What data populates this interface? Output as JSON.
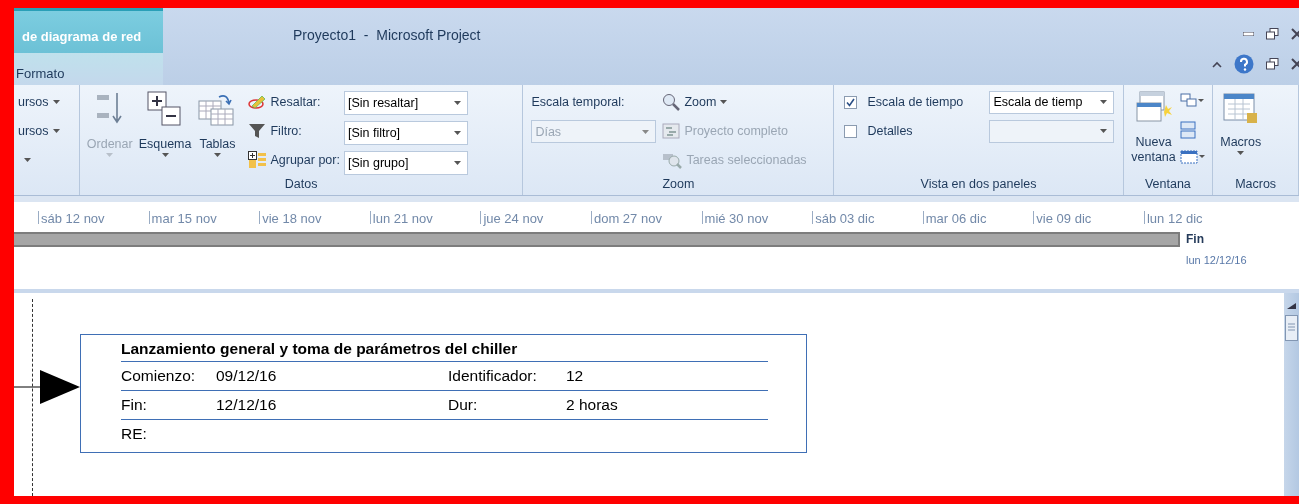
{
  "window": {
    "title": "Proyecto1  -  Microsoft Project"
  },
  "context_tab": {
    "label": "de diagrama de red",
    "tab": "Formato"
  },
  "ribbon": {
    "cut_group": {
      "items": [
        "ursos",
        "ursos"
      ]
    },
    "datos": {
      "label": "Datos",
      "buttons": [
        {
          "kind": "sort",
          "label": "Ordenar",
          "disabled": true
        },
        {
          "kind": "outline",
          "label": "Esquema",
          "disabled": false
        },
        {
          "kind": "tables",
          "label": "Tablas",
          "disabled": false
        }
      ],
      "fields": [
        {
          "kind": "highlight",
          "label": "Resaltar:",
          "value": "[Sin resaltar]"
        },
        {
          "kind": "filter",
          "label": "Filtro:",
          "value": "[Sin filtro]"
        },
        {
          "kind": "group",
          "label": "Agrupar por:",
          "value": "[Sin grupo]"
        }
      ]
    },
    "zoom": {
      "label": "Zoom",
      "timescale_label": "Escala temporal:",
      "timescale": {
        "value": "Días",
        "disabled": true
      },
      "commands": [
        {
          "kind": "zoom",
          "label": "Zoom",
          "disabled": false
        },
        {
          "kind": "entire",
          "label": "Proyecto completo",
          "disabled": true
        },
        {
          "kind": "selected",
          "label": "Tareas seleccionadas",
          "disabled": true
        }
      ]
    },
    "split_view": {
      "label": "Vista en dos paneles",
      "rows": [
        {
          "label": "Escala de tiempo",
          "checked": true,
          "value": "Escala de tiemp"
        },
        {
          "label": "Detalles",
          "checked": false
        }
      ]
    },
    "window_group": {
      "label": "Ventana",
      "new_window": "Nueva ventana"
    },
    "macros": {
      "label": "Macros",
      "button": "Macros"
    }
  },
  "timeline": {
    "ticks": [
      "sáb 12 nov",
      "mar 15 nov",
      "vie 18 nov",
      "lun 21 nov",
      "jue 24 nov",
      "dom 27 nov",
      "mié 30 nov",
      "sáb 03 dic",
      "mar 06 dic",
      "vie 09 dic",
      "lun 12 dic"
    ],
    "end_label": "Fin",
    "end_date": "lun 12/12/16"
  },
  "network": {
    "node": {
      "title": "Lanzamiento general y toma de parámetros del chiller",
      "rows": [
        {
          "cells": [
            {
              "label": "Comienzo:",
              "value": "09/12/16"
            },
            {
              "label": "Identificador:",
              "value": "12"
            }
          ]
        },
        {
          "cells": [
            {
              "label": "Fin:",
              "value": "12/12/16"
            },
            {
              "label": "Dur:",
              "value": "2 horas"
            }
          ]
        },
        {
          "cells": [
            {
              "label": "RE:"
            }
          ]
        }
      ]
    }
  }
}
